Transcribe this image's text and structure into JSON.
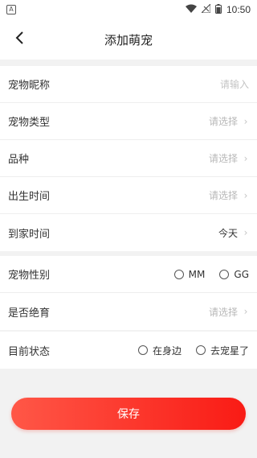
{
  "status_bar": {
    "app_badge": "A",
    "time": "10:50",
    "icons": [
      "wifi-icon",
      "signal-icon",
      "battery-icon"
    ]
  },
  "header": {
    "back_icon": "chevron-left-icon",
    "title": "添加萌宠"
  },
  "section1": {
    "rows": [
      {
        "label": "宠物昵称",
        "placeholder": "请输入"
      },
      {
        "label": "宠物类型",
        "value": "请选择"
      },
      {
        "label": "品种",
        "value": "请选择"
      },
      {
        "label": "出生时间",
        "value": "请选择"
      },
      {
        "label": "到家时间",
        "value": "今天"
      }
    ]
  },
  "section2": {
    "gender_label": "宠物性别",
    "gender_options": [
      "MM",
      "GG"
    ],
    "neuter_label": "是否绝育",
    "neuter_value": "请选择"
  },
  "section3": {
    "status_label": "目前状态",
    "status_options": [
      "在身边",
      "去宠星了"
    ]
  },
  "save_label": "保存",
  "colors": {
    "accent_start": "#ff5747",
    "accent_end": "#f91b15",
    "placeholder": "#b8b8b8"
  }
}
